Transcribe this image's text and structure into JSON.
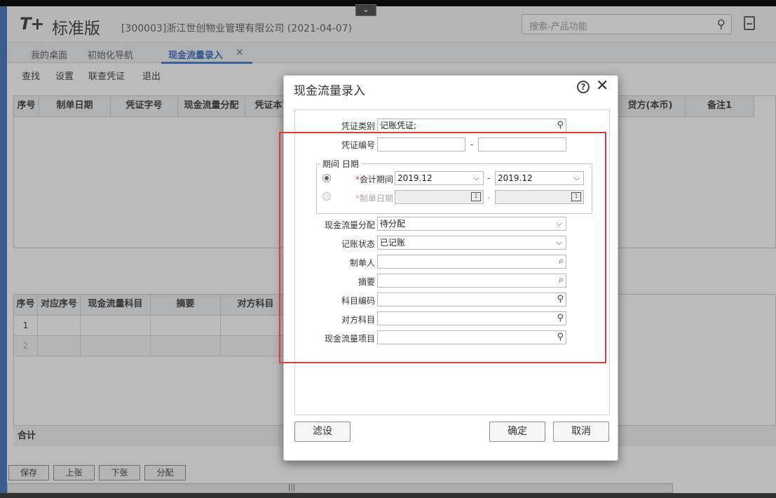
{
  "app": {
    "logo_mark": "T+",
    "logo_text": "标准版",
    "company": "[300003]浙江世创物业管理有限公司",
    "date": "(2021-04-07)",
    "search_placeholder": "搜索-产品功能",
    "collapse_glyph": "⌄"
  },
  "tabs": [
    {
      "label": "我的桌面"
    },
    {
      "label": "初始化导航"
    },
    {
      "label": "现金流量录入",
      "active": true,
      "close": "✕"
    }
  ],
  "toolbar": [
    "查找",
    "设置",
    "联查凭证",
    "退出"
  ],
  "grid1": {
    "headers": [
      "序号",
      "制单日期",
      "凭证字号",
      "现金流量分配",
      "凭证本币",
      "贷方(本币)",
      "备注1"
    ]
  },
  "grid2": {
    "headers": [
      "序号",
      "对应序号",
      "现金流量科目",
      "摘要",
      "对方科目"
    ],
    "rows": [
      "1",
      "2"
    ],
    "total_label": "合计"
  },
  "bottom_buttons": [
    "保存",
    "上张",
    "下张",
    "分配"
  ],
  "dialog": {
    "title": "现金流量录入",
    "help": "?",
    "close": "✕",
    "fields": {
      "voucher_type": {
        "label": "凭证类别",
        "value": "记账凭证;"
      },
      "voucher_no": {
        "label": "凭证编号",
        "sep": "-"
      },
      "period_group": {
        "legend": "期间 日期"
      },
      "accounting_period": {
        "label": "会计期间",
        "from": "2019.12",
        "to": "2019.12",
        "sep": "-"
      },
      "voucher_date": {
        "label": "制单日期",
        "sep": "-"
      },
      "cash_alloc": {
        "label": "现金流量分配",
        "value": "待分配"
      },
      "post_status": {
        "label": "记账状态",
        "value": "已记账"
      },
      "maker": {
        "label": "制单人"
      },
      "summary": {
        "label": "摘要"
      },
      "subject_code": {
        "label": "科目编码"
      },
      "counter_subject": {
        "label": "对方科目"
      },
      "cash_item": {
        "label": "现金流量项目"
      }
    },
    "required_mark": "*",
    "buttons": {
      "filter": "滤设",
      "ok": "确定",
      "cancel": "取消"
    }
  },
  "colors": {
    "accent": "#3b78d0",
    "highlight": "#e03a3a",
    "required": "#e03030"
  }
}
